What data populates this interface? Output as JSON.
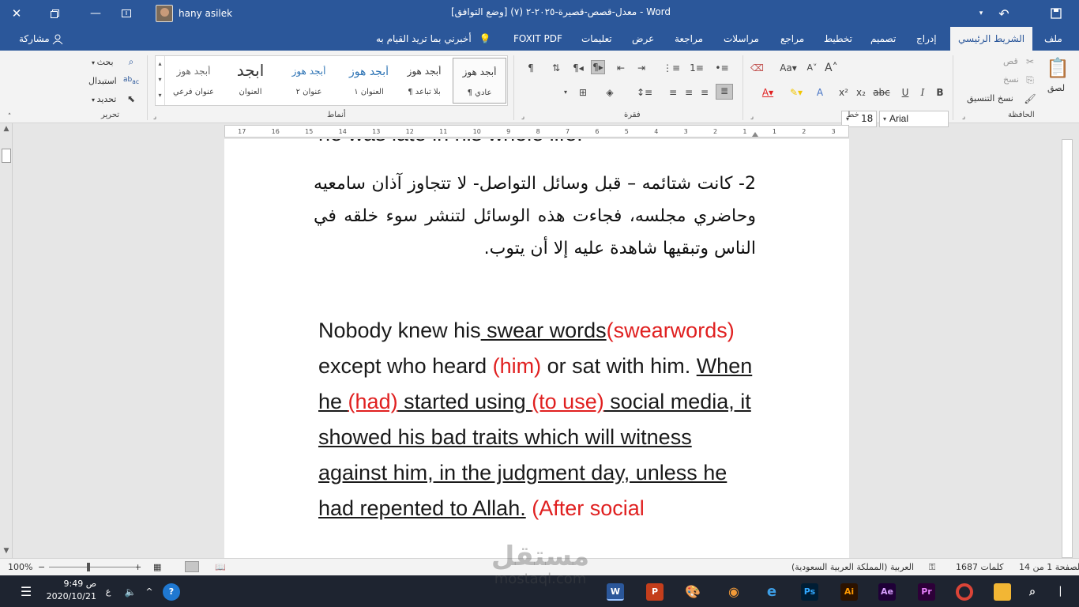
{
  "titlebar": {
    "title": "معدل-قصص-قصيرة-٢٠٢٥-٢ (٧) [وضع التوافق] - Word",
    "user": "hany asilek"
  },
  "tabs": [
    "ملف",
    "الشريط الرئيسي",
    "إدراج",
    "تصميم",
    "تخطيط",
    "مراجع",
    "مراسلات",
    "مراجعة",
    "عرض",
    "تعليمات",
    "FOXIT PDF",
    "أخبرني بما تريد القيام به",
    "مشاركة"
  ],
  "ribbon": {
    "clipboard": {
      "paste": "لصق",
      "cut": "قص",
      "copy": "نسخ",
      "format_painter": "نسخ التنسيق",
      "label": "الحافظة"
    },
    "font": {
      "name": "Arial",
      "size": "18",
      "label": "خط"
    },
    "paragraph": {
      "label": "فقرة"
    },
    "styles": {
      "label": "أنماط",
      "items": [
        {
          "sample": "أبجد هوز",
          "name": "¶ عادي"
        },
        {
          "sample": "أبجد هوز",
          "name": "¶ بلا تباعد"
        },
        {
          "sample": "أبجد هوز",
          "name": "العنوان ١"
        },
        {
          "sample": "أبجد هوز",
          "name": "عنوان ٢"
        },
        {
          "sample": "ابجد",
          "name": "العنوان"
        },
        {
          "sample": "أبجد هوز",
          "name": "عنوان فرعي"
        }
      ]
    },
    "editing": {
      "find": "بحث",
      "replace": "استبدال",
      "select": "تحديد",
      "label": "تحرير"
    }
  },
  "ruler": {
    "marks": [
      "17",
      "16",
      "15",
      "14",
      "13",
      "12",
      "11",
      "10",
      "9",
      "8",
      "7",
      "6",
      "5",
      "4",
      "3",
      "2",
      "1",
      "1",
      "2",
      "3"
    ]
  },
  "document": {
    "cut_line": "he was late in his whole life.",
    "arabic_paragraph": "2- كانت شتائمه – قبل وسائل التواصل- لا تتجاوز آذان سامعيه وحاضري مجلسه، فجاءت هذه الوسائل لتنشر سوء خلقه في الناس وتبقيها شاهدة عليه إلا أن يتوب.",
    "en": {
      "p1": "Nobody knew his",
      "p2": " swear words",
      "p3": "(swearwords)",
      "p4": " except who heard ",
      "p5": "(him)",
      "p6": " or sat with him. ",
      "p7": "When he ",
      "p8": "(had)",
      "p9": " started using ",
      "p10": "(to use)",
      "p11": " social media, it showed his bad traits which will witness against him, in the judgment day, unless he had repented to Allah.",
      "p12": " (After social"
    }
  },
  "statusbar": {
    "page": "الصفحة 1 من 14",
    "words": "1687 كلمات",
    "language": "العربية (المملكة العربية السعودية)",
    "zoom": "100%"
  },
  "taskbar": {
    "time": "9:49 ص",
    "date": "2020/10/21",
    "lang": "ع"
  },
  "watermark": {
    "brand": "مستقل",
    "site": "mostaql.com"
  },
  "colors": {
    "word_blue": "#2b579a",
    "red": "#e02020"
  }
}
